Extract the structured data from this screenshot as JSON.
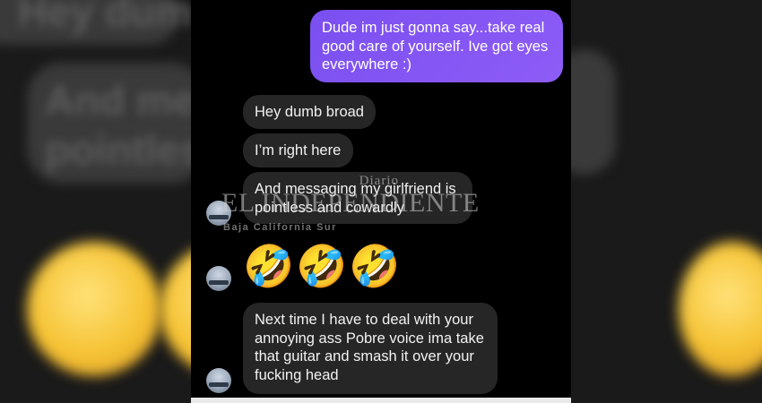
{
  "messages": {
    "outgoing_1": "Dude im just gonna say...take real\ngood care of yourself. Ive got eyes\neverywhere :)",
    "incoming_1": "Hey dumb broad",
    "incoming_2": "I’m right here",
    "incoming_3": "And messaging my girlfriend is\npointless and cowardly",
    "emojis": [
      "🤣",
      "🤣",
      "🤣"
    ],
    "incoming_4": "Next time I have to deal with your\nannoying ass Pobre voice ima take\nthat guitar and smash it over your\nfucking head"
  },
  "watermark": {
    "diario": "Diario",
    "name": "EL INDEPENDIENTE",
    "region": "Baja California Sur"
  },
  "background": {
    "left_text_1": "And mess",
    "left_text_2": "pointless",
    "left_text_top": "Hey dum"
  },
  "colors": {
    "outgoing_bubble": "#8a59f5",
    "incoming_bubble": "#262626",
    "chat_background": "#000000"
  },
  "icons": [
    "avatar-icon",
    "rolling-laughing-emoji"
  ]
}
